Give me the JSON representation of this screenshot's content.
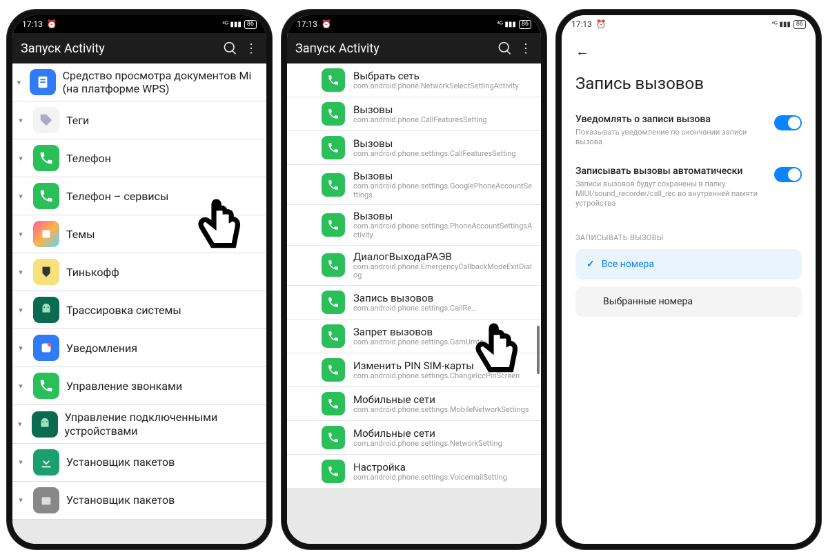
{
  "status": {
    "time": "17:13",
    "battery": "86"
  },
  "appbar": {
    "title": "Запуск Activity"
  },
  "phone1": {
    "items": [
      {
        "label": "Средство просмотра документов Mi (на платформе WPS)",
        "iconBg": "#2f7cf6",
        "iconType": "doc"
      },
      {
        "label": "Теги",
        "iconBg": "#f3f3f3",
        "iconType": "tag"
      },
      {
        "label": "Телефон",
        "iconBg": "#2bbf5a",
        "iconType": "phone"
      },
      {
        "label": "Телефон – сервисы",
        "iconBg": "#2bbf5a",
        "iconType": "phone"
      },
      {
        "label": "Темы",
        "iconBg": "linear",
        "iconType": "theme"
      },
      {
        "label": "Тинькофф",
        "iconBg": "#f7e17a",
        "iconType": "tink"
      },
      {
        "label": "Трассировка системы",
        "iconBg": "#0b6b4f",
        "iconType": "droid"
      },
      {
        "label": "Уведомления",
        "iconBg": "#2f7cf6",
        "iconType": "notif"
      },
      {
        "label": "Управление звонками",
        "iconBg": "#2bbf5a",
        "iconType": "phone"
      },
      {
        "label": "Управление подключенными устройствами",
        "iconBg": "#0b6b4f",
        "iconType": "droid"
      },
      {
        "label": "Установщик пакетов",
        "iconBg": "#1aa06e",
        "iconType": "down"
      },
      {
        "label": "Установщик пакетов",
        "iconBg": "#888",
        "iconType": "box"
      }
    ]
  },
  "phone2": {
    "items": [
      {
        "t1": "Выбрать сеть",
        "t2": "com.android.phone.NetworkSelectSettingActivity"
      },
      {
        "t1": "Вызовы",
        "t2": "com.android.phone.CallFeaturesSetting"
      },
      {
        "t1": "Вызовы",
        "t2": "com.android.phone.settings.CallFeaturesSetting"
      },
      {
        "t1": "Вызовы",
        "t2": "com.android.phone.settings.GooglePhoneAccountSettings"
      },
      {
        "t1": "Вызовы",
        "t2": "com.android.phone.settings.PhoneAccountSettingsActivity"
      },
      {
        "t1": "ДиалогВыходаРАЭВ",
        "t2": "com.android.phone.EmergencyCallbackModeExitDialog"
      },
      {
        "t1": "Запись вызовов",
        "t2": "com.android.phone.settings.CallRe…"
      },
      {
        "t1": "Запрет вызовов",
        "t2": "com.android.phone.settings.GsmUmts…ons"
      },
      {
        "t1": "Изменить PIN SIM-карты",
        "t2": "com.android.phone.settings.ChangeIccPinScreen"
      },
      {
        "t1": "Мобильные сети",
        "t2": "com.android.phone.settings.MobileNetworkSettings"
      },
      {
        "t1": "Мобильные сети",
        "t2": "com.android.phone.settings.NetworkSetting"
      },
      {
        "t1": "Настройка",
        "t2": "com.android.phone.settings.VoicemailSetting"
      }
    ]
  },
  "phone3": {
    "title": "Запись вызовов",
    "opt1": {
      "h": "Уведомлять о записи вызова",
      "d": "Показывать уведомление по окончании записи вызова"
    },
    "opt2": {
      "h": "Записывать вызовы автоматически",
      "d": "Записи вызовов будут сохранены в папку MIUI/sound_recorder/call_rec во внутренней памяти устройства"
    },
    "section": "ЗАПИСЫВАТЬ ВЫЗОВЫ",
    "choice1": "Все номера",
    "choice2": "Выбранные номера"
  }
}
